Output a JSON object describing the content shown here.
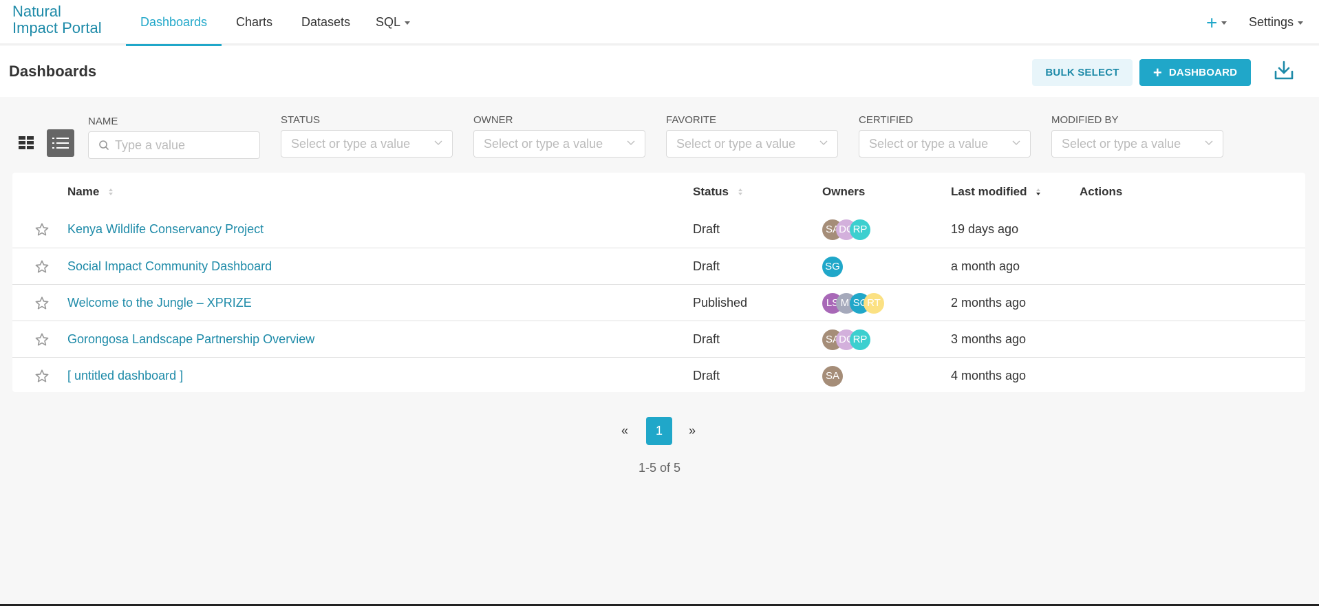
{
  "nav": {
    "brand_line1": "Natural",
    "brand_line2": "Impact Portal",
    "tabs": [
      {
        "label": "Dashboards",
        "active": true
      },
      {
        "label": "Charts"
      },
      {
        "label": "Datasets"
      },
      {
        "label": "SQL",
        "dropdown": true
      }
    ],
    "new_menu_icon": "plus-icon",
    "settings_label": "Settings"
  },
  "header": {
    "title": "Dashboards",
    "bulk_select_label": "BULK SELECT",
    "add_dashboard_label": "DASHBOARD",
    "download_icon": "download-icon"
  },
  "filters": [
    {
      "label": "NAME",
      "placeholder": "Type a value",
      "type": "search"
    },
    {
      "label": "STATUS",
      "placeholder": "Select or type a value",
      "type": "select"
    },
    {
      "label": "OWNER",
      "placeholder": "Select or type a value",
      "type": "select"
    },
    {
      "label": "FAVORITE",
      "placeholder": "Select or type a value",
      "type": "select"
    },
    {
      "label": "CERTIFIED",
      "placeholder": "Select or type a value",
      "type": "select"
    },
    {
      "label": "MODIFIED BY",
      "placeholder": "Select or type a value",
      "type": "select"
    }
  ],
  "table": {
    "columns": {
      "name": "Name",
      "status": "Status",
      "owners": "Owners",
      "last_modified": "Last modified",
      "actions": "Actions"
    },
    "rows": [
      {
        "name": "Kenya Wildlife Conservancy Project",
        "status": "Draft",
        "owners": [
          {
            "initials": "SA",
            "color": "#a58d78"
          },
          {
            "initials": "DC",
            "color": "#d3b0dc"
          },
          {
            "initials": "RP",
            "color": "#3ccfcf"
          }
        ],
        "last_modified": "19 days ago"
      },
      {
        "name": "Social Impact Community Dashboard",
        "status": "Draft",
        "owners": [
          {
            "initials": "SG",
            "color": "#20a7c9"
          }
        ],
        "last_modified": "a month ago"
      },
      {
        "name": "Welcome to the Jungle – XPRIZE",
        "status": "Published",
        "owners": [
          {
            "initials": "LS",
            "color": "#a868b7"
          },
          {
            "initials": "MI",
            "color": "#a5a9bb"
          },
          {
            "initials": "SC",
            "color": "#20a7c9"
          },
          {
            "initials": "RT",
            "color": "#fbe183"
          }
        ],
        "last_modified": "2 months ago"
      },
      {
        "name": "Gorongosa Landscape Partnership Overview",
        "status": "Draft",
        "owners": [
          {
            "initials": "SA",
            "color": "#a58d78"
          },
          {
            "initials": "DC",
            "color": "#d3b0dc"
          },
          {
            "initials": "RP",
            "color": "#3ccfcf"
          }
        ],
        "last_modified": "3 months ago"
      },
      {
        "name": "[ untitled dashboard ]",
        "status": "Draft",
        "owners": [
          {
            "initials": "SA",
            "color": "#a58d78"
          }
        ],
        "last_modified": "4 months ago"
      }
    ]
  },
  "pagination": {
    "prev": "«",
    "current": "1",
    "next": "»",
    "range_text": "1-5 of 5"
  },
  "colors": {
    "accent": "#20a7c9",
    "link": "#1d8aa8",
    "bulk_bg": "#e8f5fa"
  }
}
